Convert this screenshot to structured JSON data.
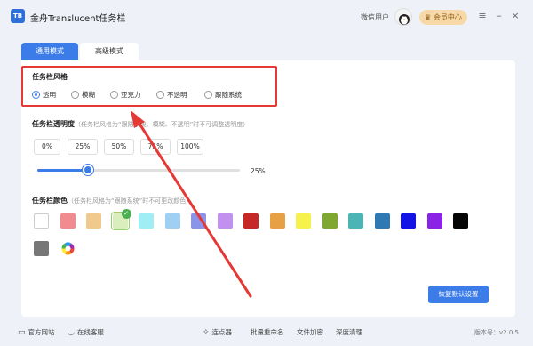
{
  "app": {
    "logo_text": "TB",
    "title": "金舟Translucent任务栏"
  },
  "header": {
    "user_name": "微信用户",
    "vip_label": "会员中心"
  },
  "tabs": [
    {
      "label": "通用模式",
      "active": true
    },
    {
      "label": "高级模式",
      "active": false
    }
  ],
  "style_section": {
    "title": "任务栏风格",
    "options": [
      {
        "label": "透明",
        "checked": true
      },
      {
        "label": "模糊",
        "checked": false
      },
      {
        "label": "亚克力",
        "checked": false
      },
      {
        "label": "不透明",
        "checked": false
      },
      {
        "label": "跟随系统",
        "checked": false
      }
    ]
  },
  "opacity_section": {
    "title": "任务栏透明度",
    "note": "（任务栏风格为“跟随系统、模糊、不透明”时不可调整透明度）",
    "presets": [
      "0%",
      "25%",
      "50%",
      "75%",
      "100%"
    ],
    "value_fraction": 0.25,
    "value_label": "25%"
  },
  "color_section": {
    "title": "任务栏颜色",
    "note": "（任务栏风格为“跟随系统”时不可更改颜色）",
    "colors": [
      "#ffffff",
      "#f28b8f",
      "#f0c98c",
      "#d9edbd",
      "#9eeef3",
      "#9fd0f2",
      "#8a94ea",
      "#c291ef",
      "#c62828",
      "#e8a045",
      "#f6f14b",
      "#7ea82f",
      "#4bb5b5",
      "#2e78b3",
      "#1313e6",
      "#8a23e6",
      "#050505",
      "#777777"
    ],
    "selected_index": 3
  },
  "restore_label": "恢复默认设置",
  "footer": {
    "items": [
      "官方网站",
      "在线客服",
      "连点器",
      "批量重命名",
      "文件加密",
      "深度清理"
    ],
    "version": "版本号：v2.0.5"
  },
  "accent_color": "#3b7ce8",
  "annotation_color": "#e53935"
}
